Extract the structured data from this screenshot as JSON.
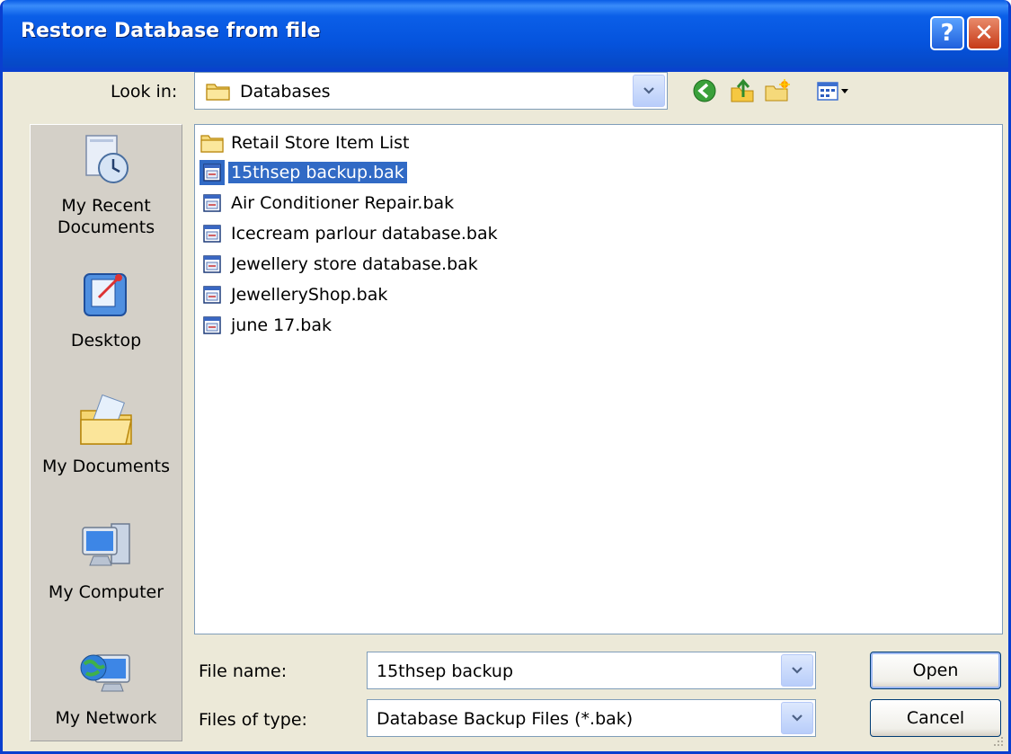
{
  "dialog": {
    "title": "Restore Database from file",
    "help_glyph": "?",
    "close_glyph": "✕"
  },
  "look_in": {
    "label": "Look in:",
    "value": "Databases",
    "icon": "folder-icon"
  },
  "toolbar": {
    "icons": [
      "back-icon",
      "up-one-level-icon",
      "new-folder-icon",
      "view-menu-icon"
    ]
  },
  "places": [
    {
      "label_lines": [
        "My Recent",
        "Documents"
      ],
      "icon": "recent-documents-icon"
    },
    {
      "label_lines": [
        "Desktop"
      ],
      "icon": "desktop-icon"
    },
    {
      "label_lines": [
        "My Documents"
      ],
      "icon": "my-documents-icon"
    },
    {
      "label_lines": [
        "My Computer"
      ],
      "icon": "my-computer-icon"
    },
    {
      "label_lines": [
        "My Network"
      ],
      "icon": "my-network-icon"
    }
  ],
  "files": [
    {
      "name": "Retail Store Item List",
      "type": "folder",
      "selected": false
    },
    {
      "name": "15thsep backup.bak",
      "type": "bak",
      "selected": true
    },
    {
      "name": "Air Conditioner Repair.bak",
      "type": "bak",
      "selected": false
    },
    {
      "name": "Icecream parlour database.bak",
      "type": "bak",
      "selected": false
    },
    {
      "name": "Jewellery store database.bak",
      "type": "bak",
      "selected": false
    },
    {
      "name": "JewelleryShop.bak",
      "type": "bak",
      "selected": false
    },
    {
      "name": "june 17.bak",
      "type": "bak",
      "selected": false
    }
  ],
  "file_name": {
    "label": "File name:",
    "value": "15thsep backup"
  },
  "file_type": {
    "label": "Files of type:",
    "value": "Database Backup Files (*.bak)"
  },
  "buttons": {
    "open": "Open",
    "cancel": "Cancel"
  },
  "colors": {
    "title_bar": "#0553dd",
    "selection": "#316ac5",
    "dialog_bg": "#ece9d8"
  }
}
